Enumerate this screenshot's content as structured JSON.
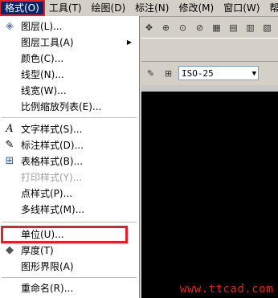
{
  "menubar": {
    "items": [
      "格式(O)",
      "工具(T)",
      "绘图(D)",
      "标注(N)",
      "修改(M)",
      "窗口(W)",
      "帮"
    ]
  },
  "format_menu": {
    "items": [
      {
        "label": "图层(L)...",
        "icon": "layers-icon",
        "enabled": true
      },
      {
        "label": "图层工具(A)",
        "icon": "",
        "enabled": true,
        "submenu": true
      },
      {
        "label": "颜色(C)...",
        "icon": "",
        "enabled": true
      },
      {
        "label": "线型(N)...",
        "icon": "",
        "enabled": true
      },
      {
        "label": "线宽(W)...",
        "icon": "",
        "enabled": true
      },
      {
        "label": "比例缩放列表(E)...",
        "icon": "",
        "enabled": true
      },
      {
        "label": "文字样式(S)...",
        "icon": "text-style-icon",
        "enabled": true
      },
      {
        "label": "标注样式(D)...",
        "icon": "dimension-style-icon",
        "enabled": true
      },
      {
        "label": "表格样式(B)...",
        "icon": "table-style-icon",
        "enabled": true
      },
      {
        "label": "打印样式(Y)...",
        "icon": "",
        "enabled": false
      },
      {
        "label": "点样式(P)...",
        "icon": "",
        "enabled": true
      },
      {
        "label": "多线样式(M)...",
        "icon": "",
        "enabled": true
      },
      {
        "label": "单位(U)...",
        "icon": "",
        "enabled": true,
        "highlighted": true
      },
      {
        "label": "厚度(T)",
        "icon": "thickness-icon",
        "enabled": true
      },
      {
        "label": "图形界限(A)",
        "icon": "",
        "enabled": true
      },
      {
        "label": "重命名(R)...",
        "icon": "",
        "enabled": true
      }
    ]
  },
  "toolbar": {
    "dimension_style": "ISO-25"
  },
  "watermark": "www.ttcad.com",
  "colors": {
    "highlight_border": "#e0202a",
    "canvas": "#000000",
    "watermark": "#e1261c"
  }
}
